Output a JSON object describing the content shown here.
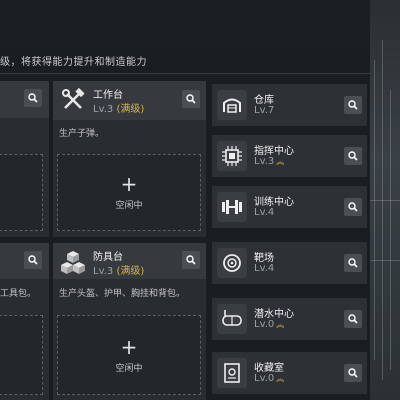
{
  "hint_text": "级，将获得能力提升和制造能力",
  "workbench": {
    "name": "工作台",
    "level": "Lv.3",
    "status": "(满级)",
    "description": "生产子弹。",
    "slot_label": "空闲中",
    "icon": "wrench-hammer-icon"
  },
  "armory": {
    "name": "防具台",
    "level": "Lv.3",
    "status": "(满级)",
    "description": "生产头盔、护甲、胸挂和背包。",
    "slot_label": "空闲中",
    "icon": "cubes-icon"
  },
  "left_column": {
    "bottom_desc": "工具包。"
  },
  "facilities": [
    {
      "name": "仓库",
      "level": "Lv.7",
      "upgrade": false,
      "icon": "warehouse-icon"
    },
    {
      "name": "指挥中心",
      "level": "Lv.3",
      "upgrade": true,
      "icon": "chip-icon"
    },
    {
      "name": "训练中心",
      "level": "Lv.4",
      "upgrade": false,
      "icon": "dumbbell-icon"
    },
    {
      "name": "靶场",
      "level": "Lv.4",
      "upgrade": false,
      "icon": "target-icon"
    },
    {
      "name": "潜水中心",
      "level": "Lv.0",
      "upgrade": true,
      "icon": "diving-mask-icon"
    },
    {
      "name": "收藏室",
      "level": "Lv.0",
      "upgrade": true,
      "icon": "collection-icon"
    }
  ],
  "colors": {
    "maxed": "#d7b24e",
    "upgrade_chevron": "#e0b54a",
    "panel": "#2a2d30",
    "panel_header": "#363a3e"
  }
}
